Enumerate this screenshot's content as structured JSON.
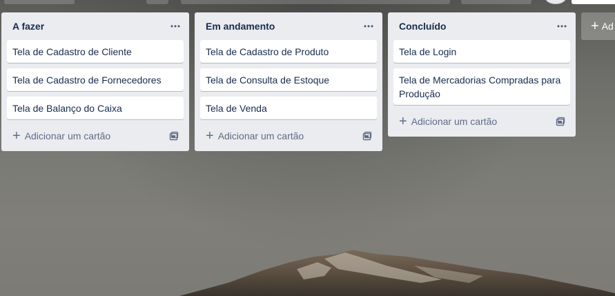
{
  "lists": [
    {
      "title": "A fazer",
      "cards": [
        "Tela de Cadastro de Cliente",
        "Tela de Cadastro de Fornecedores",
        "Tela de Balanço do Caixa"
      ],
      "add_card_label": "Adicionar um cartão"
    },
    {
      "title": "Em andamento",
      "cards": [
        "Tela de Cadastro de Produto",
        "Tela de Consulta de Estoque",
        "Tela de Venda"
      ],
      "add_card_label": "Adicionar um cartão"
    },
    {
      "title": "Concluído",
      "cards": [
        "Tela de Login",
        "Tela de Mercadorias Compradas para Produção"
      ],
      "add_card_label": "Adicionar um cartão"
    }
  ],
  "add_list": {
    "label": "Ad"
  },
  "icons": {
    "list_menu": "more-horizontal-icon",
    "add": "plus-icon",
    "template": "card-template-icon"
  },
  "colors": {
    "list_bg": "#ebecf0",
    "card_bg": "#ffffff",
    "title_text": "#172b4d",
    "muted_text": "#5e6c84"
  }
}
